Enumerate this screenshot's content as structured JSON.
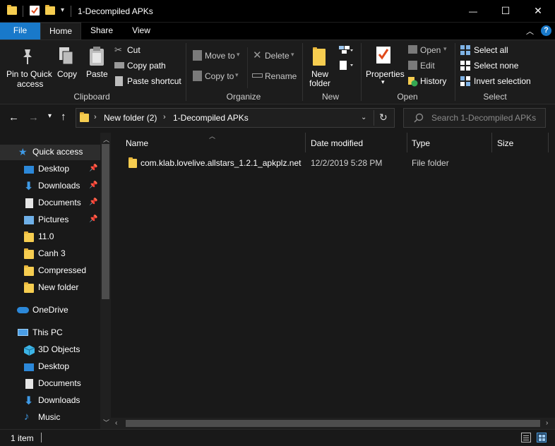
{
  "window": {
    "title": "1-Decompiled APKs",
    "minimize_glyph": "—",
    "maximize_glyph": "☐",
    "close_glyph": "✕"
  },
  "ribbon_tabs": [
    "File",
    "Home",
    "Share",
    "View"
  ],
  "ribbon": {
    "clipboard": {
      "group_label": "Clipboard",
      "pin_label_1": "Pin to Quick",
      "pin_label_2": "access",
      "copy": "Copy",
      "paste": "Paste",
      "cut": "Cut",
      "copy_path": "Copy path",
      "paste_shortcut": "Paste shortcut"
    },
    "organize": {
      "group_label": "Organize",
      "move_to": "Move to",
      "copy_to": "Copy to",
      "delete": "Delete",
      "rename": "Rename"
    },
    "new": {
      "group_label": "New",
      "new_folder_1": "New",
      "new_folder_2": "folder"
    },
    "open": {
      "group_label": "Open",
      "properties": "Properties",
      "open": "Open",
      "edit": "Edit",
      "history": "History"
    },
    "select": {
      "group_label": "Select",
      "select_all": "Select all",
      "select_none": "Select none",
      "invert_selection": "Invert selection"
    }
  },
  "address": {
    "crumbs": [
      "New folder (2)",
      "1-Decompiled APKs"
    ],
    "search_placeholder": "Search 1-Decompiled APKs"
  },
  "sidebar": {
    "quick_access": "Quick access",
    "quick_items": [
      {
        "label": "Desktop",
        "icon": "desktop-icon"
      },
      {
        "label": "Downloads",
        "icon": "downloads-icon"
      },
      {
        "label": "Documents",
        "icon": "documents-icon"
      },
      {
        "label": "Pictures",
        "icon": "pictures-icon"
      },
      {
        "label": "11.0",
        "icon": "folder-icon"
      },
      {
        "label": "Canh 3",
        "icon": "folder-icon"
      },
      {
        "label": "Compressed",
        "icon": "folder-icon"
      },
      {
        "label": "New folder",
        "icon": "folder-icon"
      }
    ],
    "onedrive": "OneDrive",
    "this_pc": "This PC",
    "pc_items": [
      {
        "label": "3D Objects",
        "icon": "3d-objects-icon"
      },
      {
        "label": "Desktop",
        "icon": "desktop-icon"
      },
      {
        "label": "Documents",
        "icon": "documents-icon"
      },
      {
        "label": "Downloads",
        "icon": "downloads-icon"
      },
      {
        "label": "Music",
        "icon": "music-icon"
      }
    ]
  },
  "columns": [
    "Name",
    "Date modified",
    "Type",
    "Size"
  ],
  "files": [
    {
      "name": "com.klab.lovelive.allstars_1.2.1_apkplz.net",
      "date": "12/2/2019 5:28 PM",
      "type": "File folder",
      "size": ""
    }
  ],
  "status": {
    "count": "1 item"
  },
  "colors": {
    "accent": "#1979ca",
    "folder": "#f6cd50",
    "background": "#191919"
  }
}
